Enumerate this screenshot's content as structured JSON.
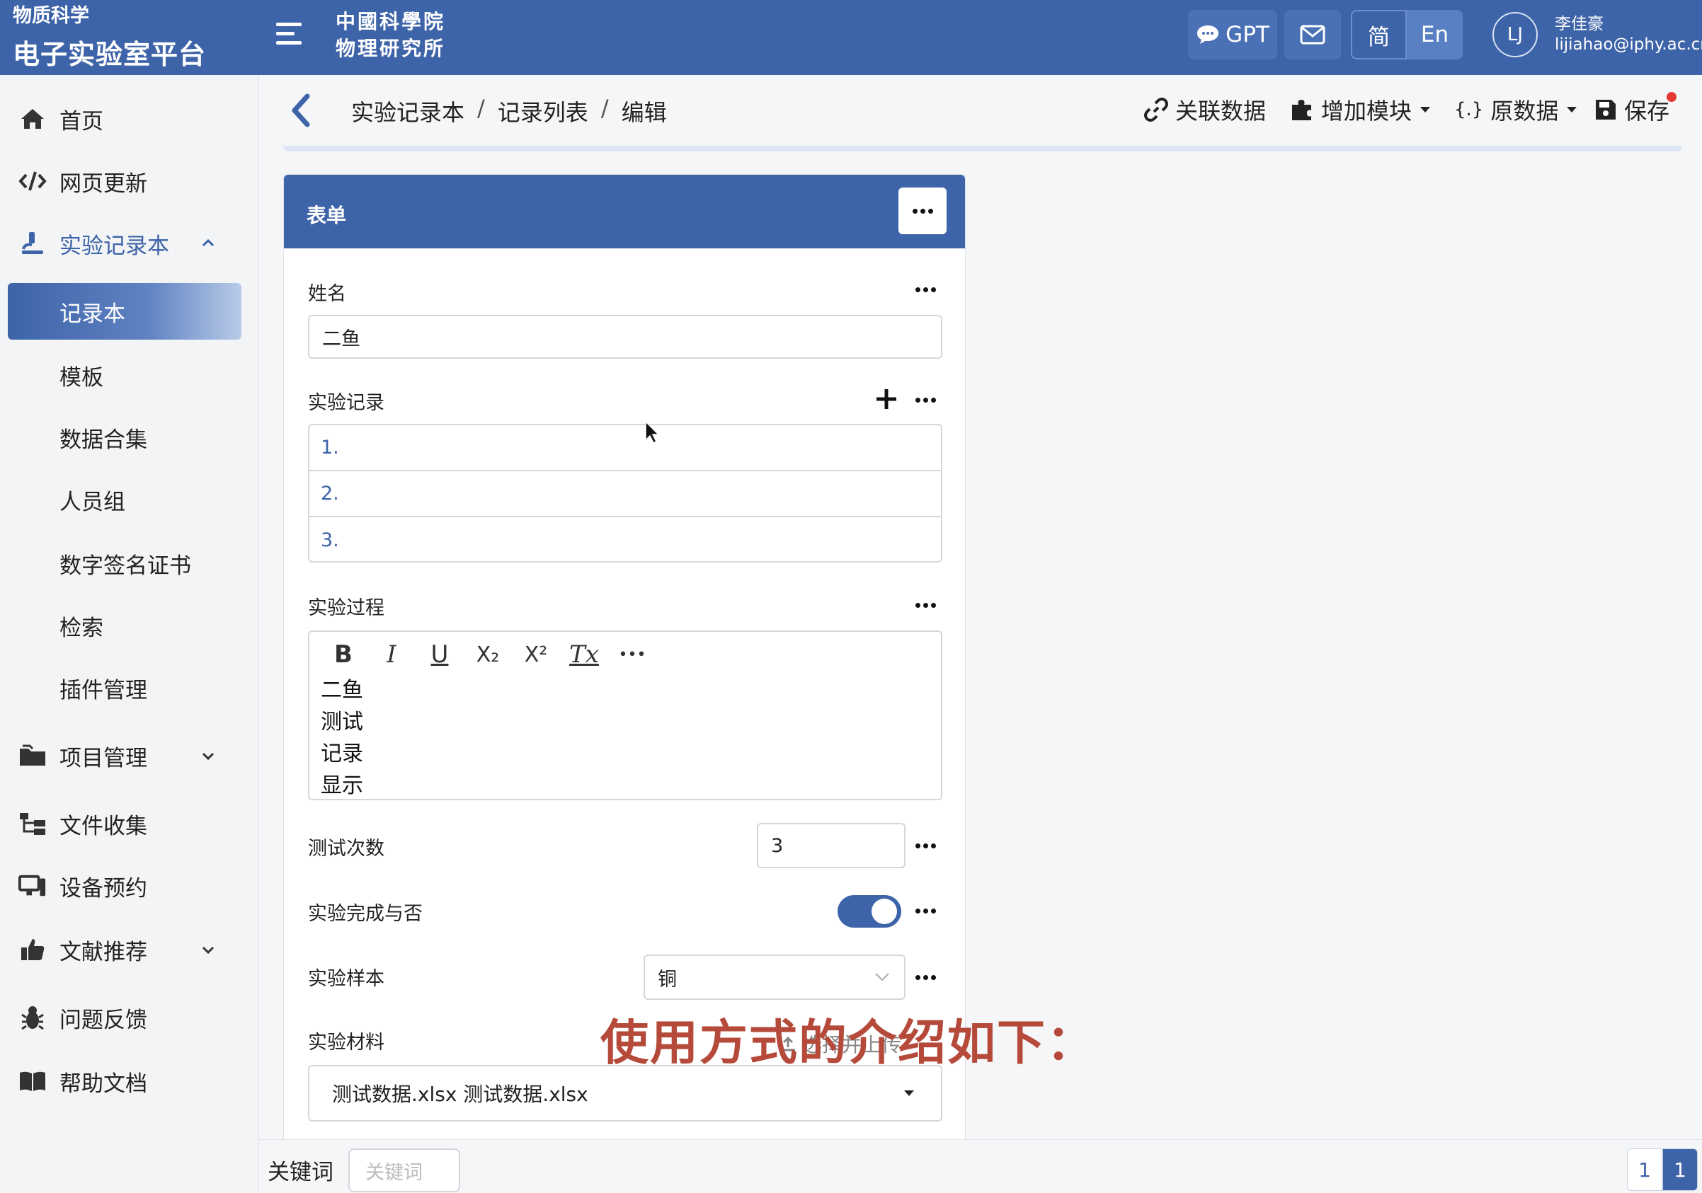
{
  "brand": {
    "subtitle": "物质科学",
    "title": "电子实验室平台"
  },
  "sidebar": {
    "items": [
      {
        "label": "首页",
        "icon": "home-icon"
      },
      {
        "label": "网页更新",
        "icon": "code-icon"
      },
      {
        "label": "实验记录本",
        "icon": "microscope-icon",
        "expanded": true
      },
      {
        "label": "记录本",
        "active": true
      },
      {
        "label": "模板"
      },
      {
        "label": "数据合集"
      },
      {
        "label": "人员组"
      },
      {
        "label": "数字签名证书"
      },
      {
        "label": "检索"
      },
      {
        "label": "插件管理"
      },
      {
        "label": "项目管理",
        "icon": "folder-icon"
      },
      {
        "label": "文件收集",
        "icon": "sitemap-icon"
      },
      {
        "label": "设备预约",
        "icon": "desktop-icon"
      },
      {
        "label": "文献推荐",
        "icon": "thumbs-up-icon"
      },
      {
        "label": "问题反馈",
        "icon": "bug-icon"
      },
      {
        "label": "帮助文档",
        "icon": "book-icon"
      }
    ]
  },
  "topbar": {
    "org_line1": "中國科學院",
    "org_line2": "物理研究所",
    "gpt_label": "GPT",
    "lang_zh": "简",
    "lang_en": "En",
    "avatar_initials": "LJ",
    "user_name": "李佳豪",
    "user_email": "lijiahao@iphy.ac.cn"
  },
  "breadcrumb": {
    "items": [
      "实验记录本",
      "记录列表",
      "编辑"
    ],
    "separator": "/"
  },
  "actions": {
    "link_data": "关联数据",
    "add_module": "增加模块",
    "raw_data": "原数据",
    "raw_data_icon": "{.}",
    "save": "保存"
  },
  "form": {
    "title": "表单",
    "name_label": "姓名",
    "name_value": "二鱼",
    "records_label": "实验记录",
    "records": [
      "1.",
      "2.",
      "3."
    ],
    "process_label": "实验过程",
    "process_lines": [
      "二鱼",
      "测试",
      "记录",
      "显示"
    ],
    "count_label": "测试次数",
    "count_value": "3",
    "done_label": "实验完成与否",
    "done_value": true,
    "sample_label": "实验样本",
    "sample_value": "铜",
    "material_label": "实验材料",
    "material_value": "测试数据.xlsx 测试数据.xlsx",
    "upload_hint": "选择并上传"
  },
  "editor_tools": [
    "B",
    "I",
    "U",
    "X₂",
    "X²",
    "Tx",
    "•••"
  ],
  "bottom": {
    "keyword_label": "关键词",
    "keyword_placeholder": "关键词",
    "page_a": "1",
    "page_b": "1"
  },
  "caption": "使用方式的介绍如下：",
  "colors": {
    "primary": "#3d63a8",
    "caption": "#b54a3a",
    "save_dot": "#e53935"
  }
}
